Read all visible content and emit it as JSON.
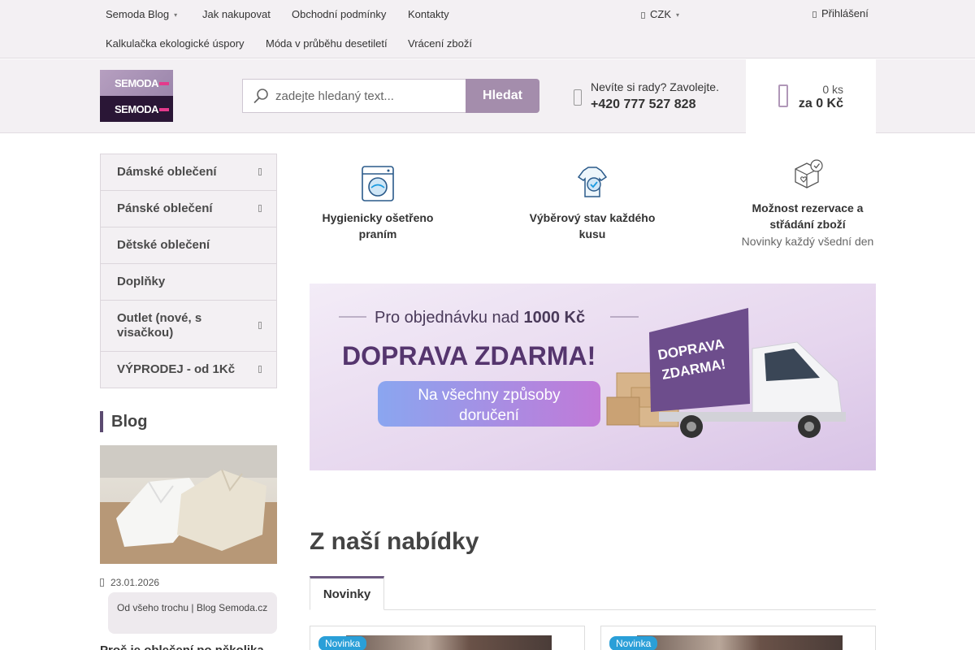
{
  "topnav": {
    "row1": [
      "Semoda Blog",
      "Jak nakupovat",
      "Obchodní podmínky",
      "Kontakty"
    ],
    "row2": [
      "Kalkulačka ekologické úspory",
      "Móda v průběhu desetiletí",
      "Vrácení zboží"
    ],
    "currency": "CZK",
    "login": "Přihlášení"
  },
  "logo": {
    "top": "SEMODA",
    "bottom": "SEMODA"
  },
  "search": {
    "placeholder": "zadejte hledaný text...",
    "button": "Hledat"
  },
  "contact": {
    "question": "Nevíte si rady? Zavolejte.",
    "phone": "+420 777 527 828"
  },
  "cart": {
    "qty": "0 ks",
    "total": "za 0 Kč"
  },
  "menu": [
    {
      "label": "Dámské oblečení",
      "submenu": true
    },
    {
      "label": "Pánské oblečení",
      "submenu": true
    },
    {
      "label": "Dětské oblečení",
      "submenu": false
    },
    {
      "label": "Doplňky",
      "submenu": false
    },
    {
      "label": "Outlet (nové, s visačkou)",
      "submenu": true
    },
    {
      "label": "VÝPRODEJ - od 1Kč",
      "submenu": true
    }
  ],
  "blog": {
    "title": "Blog",
    "date": "23.01.2026",
    "category": "Od všeho trochu | Blog Semoda.cz",
    "headline": "Proč je oblečení po několika"
  },
  "benefits": [
    {
      "title": "Hygienicky ošetřeno praním",
      "icon": "washing-machine-icon"
    },
    {
      "title": "Výběrový stav každého kusu",
      "icon": "shirt-tag-icon"
    },
    {
      "title": "Možnost rezervace a střádání zboží",
      "subtitle": "Novinky každý všední den",
      "icon": "package-heart-icon"
    }
  ],
  "banner": {
    "line1": "Pro objednávku nad",
    "line1_bold": "1000 Kč",
    "headline": "DOPRAVA ZDARMA!",
    "pill": "Na všechny způsoby doručení",
    "truck": "DOPRAVA ZDARMA!"
  },
  "offer": {
    "title": "Z naší nabídky",
    "tabs": [
      "Novinky"
    ],
    "badge": "Novinka"
  },
  "colors": {
    "accent": "#a48dac",
    "topbar": "#f3f0f3",
    "badge": "#2a9fd8"
  }
}
